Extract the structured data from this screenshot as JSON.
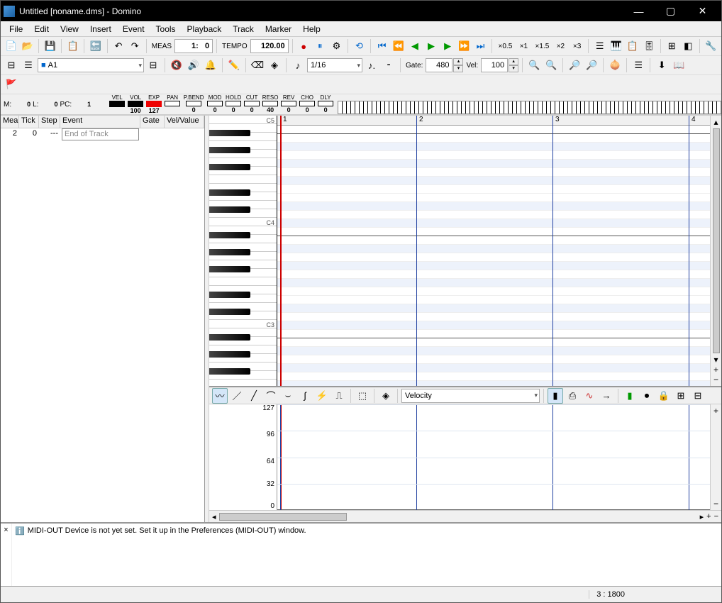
{
  "window": {
    "title": "Untitled [noname.dms] - Domino"
  },
  "menu": [
    "File",
    "Edit",
    "View",
    "Insert",
    "Event",
    "Tools",
    "Playback",
    "Track",
    "Marker",
    "Help"
  ],
  "toolbar1": {
    "meas_label": "MEAS",
    "meas_val": "1:   0",
    "tempo_label": "TEMPO",
    "tempo_val": "120.00",
    "speed_buttons": [
      "×0.5",
      "×1",
      "×1.5",
      "×2",
      "×3"
    ]
  },
  "toolbar2": {
    "track_name": "A1",
    "note_value": "1/16",
    "gate_label": "Gate:",
    "gate_val": "480",
    "vel_label": "Vel:",
    "vel_val": "100"
  },
  "paramsbar": {
    "M": "0",
    "L": "0",
    "PC": "1",
    "cols": [
      {
        "name": "VEL",
        "val": "",
        "black": true
      },
      {
        "name": "VOL",
        "val": "100",
        "black": true
      },
      {
        "name": "EXP",
        "val": "127",
        "red": true
      },
      {
        "name": "PAN",
        "val": "",
        "hollow": true
      },
      {
        "name": "P.BEND",
        "val": "0",
        "hollow": true,
        "w": 34
      },
      {
        "name": "MOD",
        "val": "0",
        "hollow": true
      },
      {
        "name": "HOLD",
        "val": "0",
        "hollow": true
      },
      {
        "name": "CUT",
        "val": "0",
        "hollow": true
      },
      {
        "name": "RESO",
        "val": "40",
        "hollow": true
      },
      {
        "name": "REV",
        "val": "0",
        "hollow": true
      },
      {
        "name": "CHO",
        "val": "0",
        "hollow": true
      },
      {
        "name": "DLY",
        "val": "0",
        "hollow": true
      }
    ]
  },
  "eventlist": {
    "headers": [
      "Mea",
      "Tick",
      "Step",
      "Event",
      "Gate",
      "Vel/Value"
    ],
    "rows": [
      {
        "mea": "2",
        "tick": "0",
        "step": "---",
        "event": "End of Track",
        "gate": "",
        "vel": ""
      }
    ]
  },
  "pianoroll": {
    "measures": [
      "1",
      "2",
      "3",
      "4"
    ],
    "octave_labels": [
      "C5",
      "C4",
      "C3"
    ]
  },
  "ccpanel": {
    "curve_select": "Velocity",
    "scale": [
      "127",
      "96",
      "64",
      "32",
      "0"
    ]
  },
  "message": "MIDI-OUT Device is not yet set. Set it up in the Preferences (MIDI-OUT) window.",
  "statusbar": {
    "pos": "3 : 1800"
  }
}
